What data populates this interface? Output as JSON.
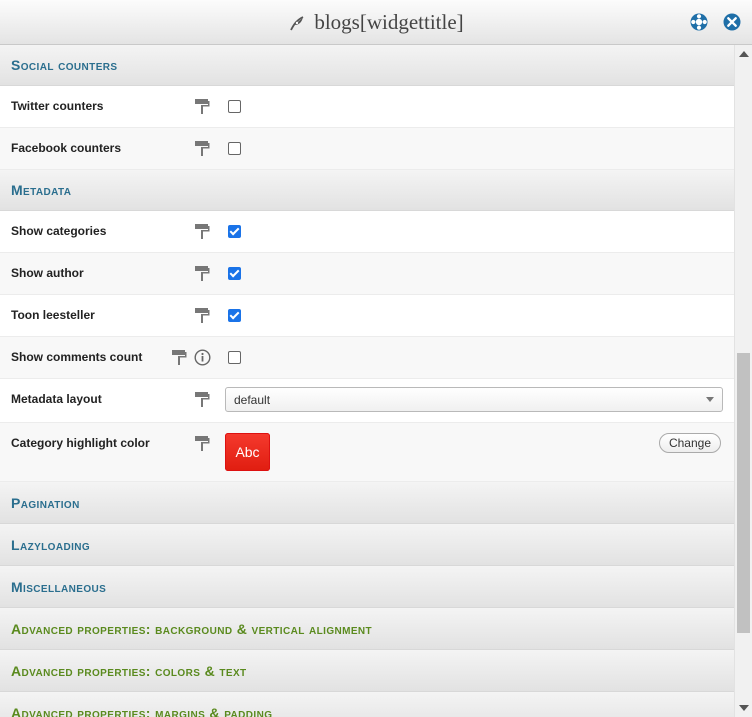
{
  "window": {
    "title": "blogs[widgettitle]",
    "title_icon": "feather-icon",
    "help_icon": "lifebuoy-icon",
    "close_icon": "close-icon"
  },
  "sections": {
    "social": "Social counters",
    "metadata": "Metadata",
    "pagination": "Pagination",
    "lazyloading": "Lazyloading",
    "misc": "Miscellaneous",
    "adv_bg": "Advanced properties: background & vertical alignment",
    "adv_colors": "Advanced properties: colors & text",
    "adv_partial": "Advanced properties: margins & padding"
  },
  "fields": {
    "twitter": {
      "label": "Twitter counters",
      "checked": false
    },
    "facebook": {
      "label": "Facebook counters",
      "checked": false
    },
    "show_categories": {
      "label": "Show categories",
      "checked": true
    },
    "show_author": {
      "label": "Show author",
      "checked": true
    },
    "toon_leesteller": {
      "label": "Toon leesteller",
      "checked": true
    },
    "show_comments": {
      "label": "Show comments count",
      "checked": false
    },
    "metadata_layout": {
      "label": "Metadata layout",
      "value": "default"
    },
    "category_color": {
      "label": "Category highlight color",
      "preview": "Abc",
      "button": "Change",
      "color": "#f0281c"
    }
  },
  "colors": {
    "accent_blue": "#2a6e8e",
    "accent_green": "#5a8a1e",
    "checkbox": "#1a73e8"
  }
}
